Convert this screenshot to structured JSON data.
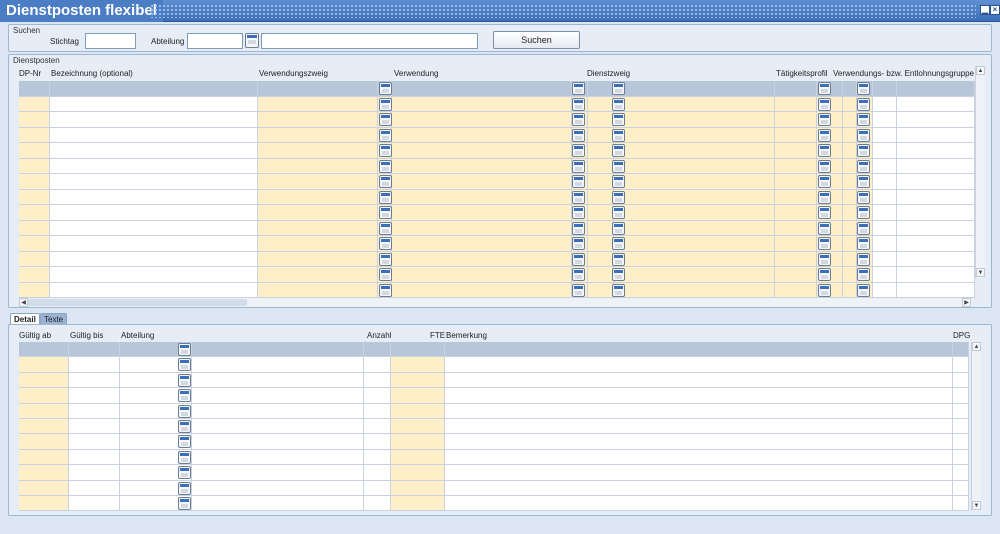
{
  "window": {
    "title": "Dienstposten flexibel",
    "minimize_icon": "minimize-icon",
    "close_icon": "close-icon"
  },
  "search": {
    "group_label": "Suchen",
    "stichtag_label": "Stichtag",
    "stichtag_value": "",
    "abteilung_label": "Abteilung",
    "abteilung_value": "",
    "abteilung_name_value": "",
    "search_button": "Suchen"
  },
  "dienstposten": {
    "group_label": "Dienstposten",
    "columns": [
      "DP-Nr",
      "Bezeichnung (optional)",
      "Verwendungszweig",
      "Verwendung",
      "Dienstzweig",
      "Tätigkeitsprofil",
      "Verwendungs- bzw. Entlohnungsgruppe"
    ]
  },
  "tabs": [
    "Detail",
    "Texte"
  ],
  "detail": {
    "columns": [
      "Gültig ab",
      "Gültig bis",
      "Abteilung",
      "Anzahl",
      "FTE",
      "Bemerkung",
      "DPG"
    ]
  },
  "colors": {
    "title_bar": "#4a7dc4",
    "required_cell": "#fdf0c8",
    "selected_row": "#b7c6d8"
  }
}
